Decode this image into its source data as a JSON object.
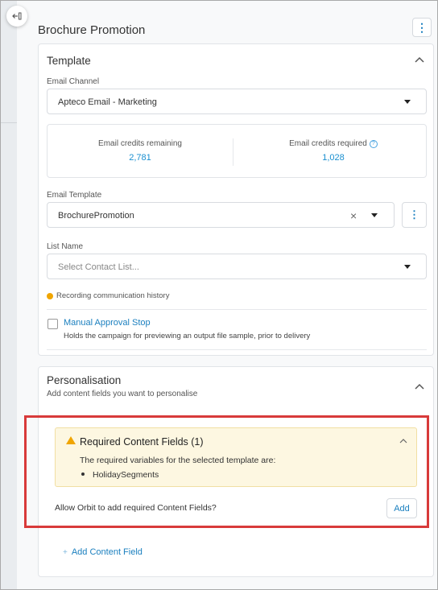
{
  "page": {
    "title": "Brochure Promotion"
  },
  "template_card": {
    "title": "Template",
    "email_channel": {
      "label": "Email Channel",
      "value": "Apteco Email - Marketing"
    },
    "credits": {
      "remaining_label": "Email credits remaining",
      "remaining_value": "2,781",
      "required_label": "Email credits required",
      "required_value": "1,028",
      "help_symbol": "?"
    },
    "email_template": {
      "label": "Email Template",
      "value": "BrochurePromotion",
      "clear_symbol": "×"
    },
    "list_name": {
      "label": "List Name",
      "placeholder": "Select Contact List..."
    },
    "recording_note": "Recording communication history",
    "manual_approval": {
      "title": "Manual Approval Stop",
      "description": "Holds the campaign for previewing an output file sample, prior to delivery",
      "checked": false
    }
  },
  "personalisation_card": {
    "title": "Personalisation",
    "subtitle": "Add content fields you want to personalise",
    "required_fields": {
      "title": "Required Content Fields (1)",
      "text": "The required variables for the selected template are:",
      "items": [
        "HolidaySegments"
      ]
    },
    "allow_prompt": "Allow Orbit to add required Content Fields?",
    "add_button": "Add",
    "add_content_field": "Add Content Field",
    "add_symbol": "+"
  },
  "icons": {
    "collapse_panel": "collapse-panel-icon",
    "kebab": "more-vertical-icon",
    "chevron": "chevron-up-icon",
    "warning": "warning-icon",
    "dropdown": "caret-down-icon"
  },
  "colors": {
    "accent": "#1a7fbf",
    "credit_number": "#1a8fd0",
    "warning": "#f0a500",
    "warning_bg": "#fdf7e1",
    "highlight_border": "#d83a3a"
  }
}
